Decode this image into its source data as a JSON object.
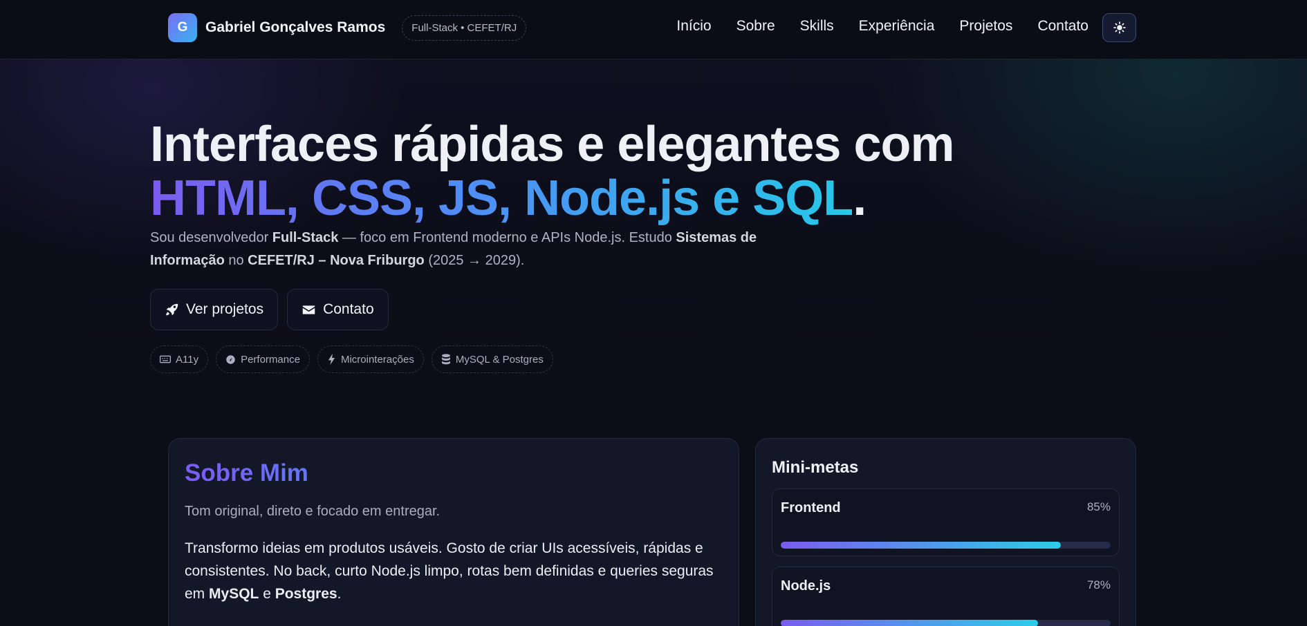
{
  "header": {
    "logo_letter": "G",
    "brand_name": "Gabriel Gonçalves Ramos",
    "badge": "Full-Stack • CEFET/RJ",
    "nav": [
      "Início",
      "Sobre",
      "Skills",
      "Experiência",
      "Projetos",
      "Contato"
    ],
    "theme_toggle_icon": "sun-icon"
  },
  "hero": {
    "title_line1": "Interfaces rápidas e elegantes com",
    "title_gradient": "HTML, CSS, JS, Node.js e SQL",
    "title_end": ".",
    "lead": {
      "p1": "Sou desenvolvedor ",
      "b1": "Full-Stack",
      "p2": " — foco em Frontend moderno e APIs Node.js. Estudo ",
      "b2": "Sistemas de Informação",
      "p3": " no ",
      "b3": "CEFET/RJ – Nova Friburgo",
      "p4": " (2025 → 2029)."
    },
    "buttons": [
      {
        "label": "Ver projetos",
        "icon": "rocket-icon"
      },
      {
        "label": "Contato",
        "icon": "envelope-icon"
      }
    ],
    "chips": [
      {
        "label": "A11y",
        "icon": "keyboard-icon"
      },
      {
        "label": "Performance",
        "icon": "gauge-icon"
      },
      {
        "label": "Microinterações",
        "icon": "bolt-icon"
      },
      {
        "label": "MySQL & Postgres",
        "icon": "database-icon"
      }
    ]
  },
  "about": {
    "title": "Sobre Mim",
    "tagline": "Tom original, direto e focado em entregar.",
    "body": {
      "p1": "Transformo ideias em produtos usáveis. Gosto de criar UIs acessíveis, rápidas e consistentes. No back, curto Node.js limpo, rotas bem definidas e queries seguras em ",
      "b1": "MySQL",
      "p2": " e ",
      "b2": "Postgres",
      "p3": "."
    }
  },
  "goals": {
    "title": "Mini-metas",
    "items": [
      {
        "name": "Frontend",
        "percent_label": "85%",
        "percent": 85
      },
      {
        "name": "Node.js",
        "percent_label": "78%",
        "percent": 78
      }
    ]
  },
  "colors": {
    "accent_purple": "#7b5cf0",
    "accent_blue": "#4f8df5",
    "accent_cyan": "#27c8e8",
    "background": "#0b0d17"
  }
}
